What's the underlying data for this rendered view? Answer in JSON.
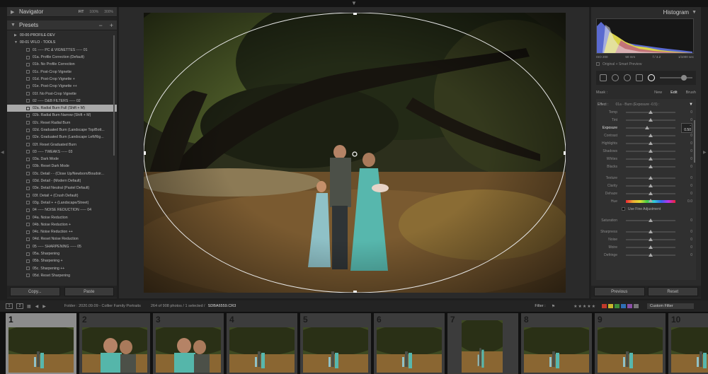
{
  "navigator": {
    "title": "Navigator",
    "options": [
      "FIT",
      "100%",
      "300%"
    ]
  },
  "presets": {
    "title": "Presets",
    "minus": "−",
    "plus": "+",
    "rows": [
      {
        "label": "00-00-PROFILE-DEV",
        "kind": "folder",
        "expanded": false
      },
      {
        "label": "00-01 VFLO - TOOLS",
        "kind": "folder",
        "expanded": true
      },
      {
        "label": "01 ----- PC & VIGNETTES ----- 01",
        "kind": "item"
      },
      {
        "label": "01a. Profile Correction (Default)",
        "kind": "item"
      },
      {
        "label": "01b. No Profile Correction",
        "kind": "item"
      },
      {
        "label": "01c. Post-Crop Vignette",
        "kind": "item"
      },
      {
        "label": "01d. Post-Crop Vignette +",
        "kind": "item"
      },
      {
        "label": "01e. Post-Crop Vignette ++",
        "kind": "item"
      },
      {
        "label": "01f. No Post-Crop Vignette",
        "kind": "item"
      },
      {
        "label": "02 ----- D&B FILTERS ----- 02",
        "kind": "item"
      },
      {
        "label": "02a. Radial Burn Full (Shift + M)",
        "kind": "item",
        "selected": true
      },
      {
        "label": "02b. Radial Burn Narrow (Shift + M)",
        "kind": "item"
      },
      {
        "label": "02c. Reset Radial Burn",
        "kind": "item"
      },
      {
        "label": "02d. Graduated Burn (Landscape Top/Bott...",
        "kind": "item"
      },
      {
        "label": "02e. Graduated Burn (Landscape Left/Rig...",
        "kind": "item"
      },
      {
        "label": "02f. Reset Graduated Burn",
        "kind": "item"
      },
      {
        "label": "03 ----- TWEAKS ----- 03",
        "kind": "item"
      },
      {
        "label": "03a. Dark Mode",
        "kind": "item"
      },
      {
        "label": "03b. Reset Dark Mode",
        "kind": "item"
      },
      {
        "label": "03c. Detail - - (Close Up/Newborn/Boudoir...",
        "kind": "item"
      },
      {
        "label": "03d. Detail - (Modern Default)",
        "kind": "item"
      },
      {
        "label": "03e. Detail Neutral (Pastel Default)",
        "kind": "item"
      },
      {
        "label": "03f. Detail + (Crush Default)",
        "kind": "item"
      },
      {
        "label": "03g. Detail + + (Landscape/Street)",
        "kind": "item"
      },
      {
        "label": "04 ----- NOISE REDUCTION ----- 04",
        "kind": "item"
      },
      {
        "label": "04a. Noise Reduction",
        "kind": "item"
      },
      {
        "label": "04b. Noise Reduction +",
        "kind": "item"
      },
      {
        "label": "04c. Noise Reduction ++",
        "kind": "item"
      },
      {
        "label": "04d. Reset Noise Reduction",
        "kind": "item"
      },
      {
        "label": "05 ----- SHARPENING ----- 05",
        "kind": "item"
      },
      {
        "label": "05a. Sharpening",
        "kind": "item"
      },
      {
        "label": "05b. Sharpening +",
        "kind": "item"
      },
      {
        "label": "05c. Sharpening ++",
        "kind": "item"
      },
      {
        "label": "05d. Reset Sharpening",
        "kind": "item"
      }
    ],
    "copy_label": "Copy...",
    "paste_label": "Paste"
  },
  "histogram": {
    "title": "Histogram",
    "readout": [
      "ISO 200",
      "50 mm",
      "f / 3.2",
      "1/1000 sec"
    ],
    "smart_preview": "Original + Smart Preview"
  },
  "mask": {
    "label": "Mask :",
    "new": "New",
    "edit": "Edit",
    "brush": "Brush",
    "effect_label": "Effect :",
    "effect_value": "01a - Burn (Exposure -0.5) :"
  },
  "sliders": [
    {
      "label": "Temp",
      "value": "0",
      "pos": 0.5
    },
    {
      "label": "Tint",
      "value": "0",
      "pos": 0.5
    },
    {
      "label": "Exposure",
      "value": "- 0.50",
      "pos": 0.43,
      "active": true
    },
    {
      "label": "Contrast",
      "value": "0",
      "pos": 0.5
    },
    {
      "label": "Highlights",
      "value": "0",
      "pos": 0.5
    },
    {
      "label": "Shadows",
      "value": "0",
      "pos": 0.5
    },
    {
      "label": "Whites",
      "value": "0",
      "pos": 0.5
    },
    {
      "label": "Blacks",
      "value": "0",
      "pos": 0.5
    },
    {
      "label": "Texture",
      "value": "0",
      "pos": 0.5
    },
    {
      "label": "Clarity",
      "value": "0",
      "pos": 0.5
    },
    {
      "label": "Dehaze",
      "value": "0",
      "pos": 0.5
    },
    {
      "label": "Hue",
      "value": "0.0",
      "pos": 0.5,
      "hue": true
    },
    {
      "label": "Saturation",
      "value": "0",
      "pos": 0.5
    },
    {
      "label": "Sharpness",
      "value": "0",
      "pos": 0.5
    },
    {
      "label": "Noise",
      "value": "0",
      "pos": 0.5
    },
    {
      "label": "Moire",
      "value": "0",
      "pos": 0.5
    },
    {
      "label": "Defringe",
      "value": "0",
      "pos": 0.5
    }
  ],
  "use_fine": "Use Fine Adjustment",
  "color_label": "Color",
  "right_buttons": {
    "previous": "Previous",
    "reset": "Reset"
  },
  "filmbar": {
    "page1": "1",
    "page2": "2",
    "folder": "Folder : 2020.09.09 - Collier Family Portraits",
    "count": "264 of 908 photos / 1 selected /",
    "filename": "SDBA6559.CR3",
    "filter_label": "Filter :",
    "custom_filter": "Custom Filter",
    "label_colors": [
      "#c0392b",
      "#c8b62c",
      "#3e8d3a",
      "#2f6fb5",
      "#8b4fa6",
      "#777777"
    ]
  },
  "filmstrip": [
    {
      "num": "1",
      "selected": true
    },
    {
      "num": "2"
    },
    {
      "num": "3"
    },
    {
      "num": "4"
    },
    {
      "num": "5"
    },
    {
      "num": "6"
    },
    {
      "num": "7",
      "portrait": true
    },
    {
      "num": "8"
    },
    {
      "num": "9"
    },
    {
      "num": "10"
    }
  ]
}
